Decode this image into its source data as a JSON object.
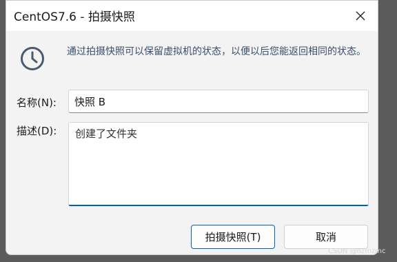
{
  "window": {
    "title": "CentOS7.6 - 拍摄快照"
  },
  "icons": {
    "close": "close-icon",
    "clock": "clock-icon"
  },
  "description": "通过拍摄快照可以保留虚拟机的状态，以便以后您能返回相同的状态。",
  "form": {
    "name_label": "名称(N):",
    "name_value": "快照 B",
    "desc_label": "描述(D):",
    "desc_value": "创建了文件夹"
  },
  "buttons": {
    "take_snapshot": "拍摄快照(T)",
    "cancel": "取消"
  },
  "watermark": "CSDN @nzmzmc",
  "colors": {
    "accent": "#005fb8",
    "icon": "#4a5a6e"
  }
}
